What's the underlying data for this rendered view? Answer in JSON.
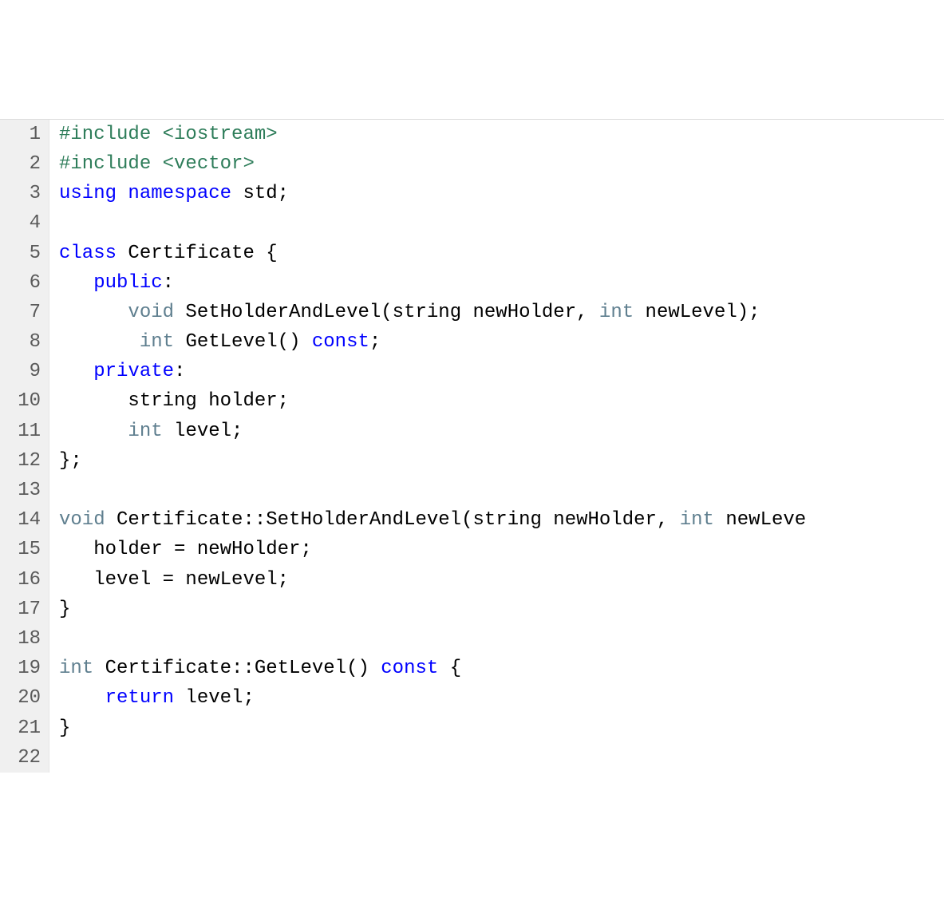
{
  "gutter": {
    "start": 1,
    "end": 22
  },
  "colors": {
    "preprocessor": "#2e7d5a",
    "keyword": "#0000ff",
    "type": "#5f7f8f",
    "plain": "#000000",
    "gutter_bg": "#f0f0f0",
    "gutter_fg": "#5a5a5a"
  },
  "lines": [
    {
      "n": 1,
      "tokens": [
        {
          "cls": "pre",
          "t": "#include <iostream>"
        }
      ]
    },
    {
      "n": 2,
      "tokens": [
        {
          "cls": "pre",
          "t": "#include <vector>"
        }
      ]
    },
    {
      "n": 3,
      "tokens": [
        {
          "cls": "kw",
          "t": "using"
        },
        {
          "cls": "plain",
          "t": " "
        },
        {
          "cls": "kw",
          "t": "namespace"
        },
        {
          "cls": "plain",
          "t": " std;"
        }
      ]
    },
    {
      "n": 4,
      "tokens": [
        {
          "cls": "plain",
          "t": ""
        }
      ]
    },
    {
      "n": 5,
      "tokens": [
        {
          "cls": "kw",
          "t": "class"
        },
        {
          "cls": "plain",
          "t": " Certificate {"
        }
      ]
    },
    {
      "n": 6,
      "tokens": [
        {
          "cls": "plain",
          "t": "   "
        },
        {
          "cls": "kw",
          "t": "public"
        },
        {
          "cls": "plain",
          "t": ":"
        }
      ]
    },
    {
      "n": 7,
      "tokens": [
        {
          "cls": "plain",
          "t": "      "
        },
        {
          "cls": "type",
          "t": "void"
        },
        {
          "cls": "plain",
          "t": " SetHolderAndLevel(string newHolder, "
        },
        {
          "cls": "type",
          "t": "int"
        },
        {
          "cls": "plain",
          "t": " newLevel);"
        }
      ]
    },
    {
      "n": 8,
      "tokens": [
        {
          "cls": "plain",
          "t": "       "
        },
        {
          "cls": "type",
          "t": "int"
        },
        {
          "cls": "plain",
          "t": " GetLevel() "
        },
        {
          "cls": "kw",
          "t": "const"
        },
        {
          "cls": "plain",
          "t": ";"
        }
      ]
    },
    {
      "n": 9,
      "tokens": [
        {
          "cls": "plain",
          "t": "   "
        },
        {
          "cls": "kw",
          "t": "private"
        },
        {
          "cls": "plain",
          "t": ":"
        }
      ]
    },
    {
      "n": 10,
      "tokens": [
        {
          "cls": "plain",
          "t": "      string holder;"
        }
      ]
    },
    {
      "n": 11,
      "tokens": [
        {
          "cls": "plain",
          "t": "      "
        },
        {
          "cls": "type",
          "t": "int"
        },
        {
          "cls": "plain",
          "t": " level;"
        }
      ]
    },
    {
      "n": 12,
      "tokens": [
        {
          "cls": "plain",
          "t": "};"
        }
      ]
    },
    {
      "n": 13,
      "tokens": [
        {
          "cls": "plain",
          "t": ""
        }
      ]
    },
    {
      "n": 14,
      "tokens": [
        {
          "cls": "type",
          "t": "void"
        },
        {
          "cls": "plain",
          "t": " Certificate::SetHolderAndLevel(string newHolder, "
        },
        {
          "cls": "type",
          "t": "int"
        },
        {
          "cls": "plain",
          "t": " newLeve"
        }
      ]
    },
    {
      "n": 15,
      "tokens": [
        {
          "cls": "plain",
          "t": "   holder = newHolder;"
        }
      ]
    },
    {
      "n": 16,
      "tokens": [
        {
          "cls": "plain",
          "t": "   level = newLevel;"
        }
      ]
    },
    {
      "n": 17,
      "tokens": [
        {
          "cls": "plain",
          "t": "}"
        }
      ]
    },
    {
      "n": 18,
      "tokens": [
        {
          "cls": "plain",
          "t": ""
        }
      ]
    },
    {
      "n": 19,
      "tokens": [
        {
          "cls": "type",
          "t": "int"
        },
        {
          "cls": "plain",
          "t": " Certificate::GetLevel() "
        },
        {
          "cls": "kw",
          "t": "const"
        },
        {
          "cls": "plain",
          "t": " {"
        }
      ]
    },
    {
      "n": 20,
      "tokens": [
        {
          "cls": "plain",
          "t": "    "
        },
        {
          "cls": "kw",
          "t": "return"
        },
        {
          "cls": "plain",
          "t": " level;"
        }
      ]
    },
    {
      "n": 21,
      "tokens": [
        {
          "cls": "plain",
          "t": "}"
        }
      ]
    },
    {
      "n": 22,
      "tokens": [
        {
          "cls": "plain",
          "t": ""
        }
      ]
    }
  ]
}
